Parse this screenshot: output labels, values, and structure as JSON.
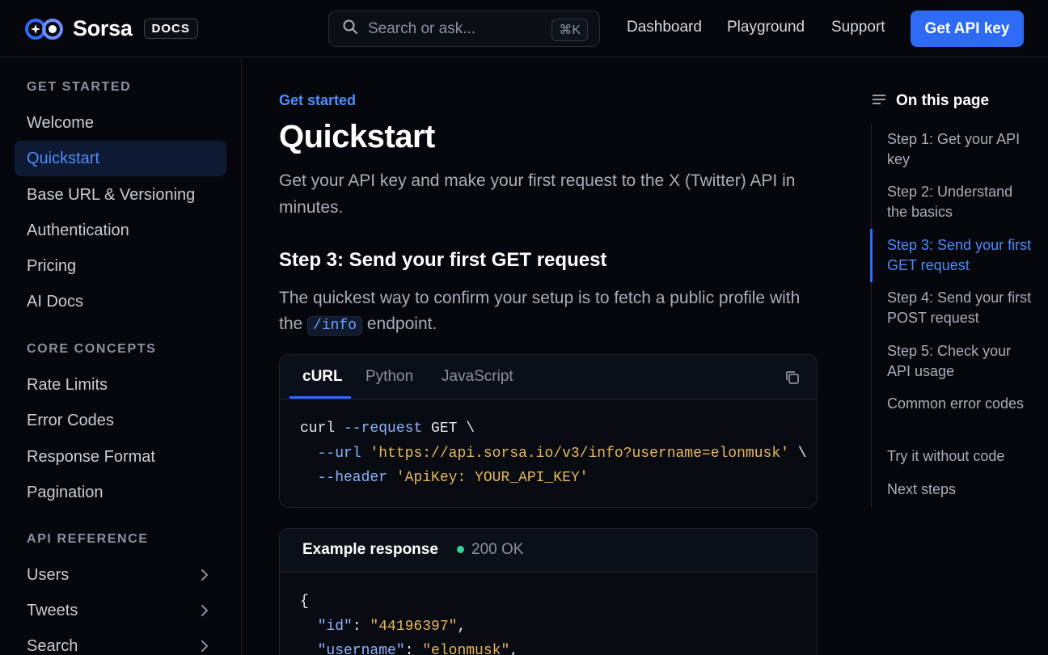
{
  "header": {
    "brand": "Sorsa",
    "badge": "DOCS",
    "search_placeholder": "Search or ask...",
    "search_shortcut": "⌘K",
    "nav": [
      "Dashboard",
      "Playground",
      "Support"
    ],
    "cta": "Get API key"
  },
  "sidebar": {
    "sections": [
      {
        "label": "GET STARTED",
        "items": [
          "Welcome",
          "Quickstart",
          "Base URL & Versioning",
          "Authentication",
          "Pricing",
          "AI Docs"
        ]
      },
      {
        "label": "CORE CONCEPTS",
        "items": [
          "Rate Limits",
          "Error Codes",
          "Response Format",
          "Pagination"
        ]
      },
      {
        "label": "API REFERENCE",
        "items": [
          "Users",
          "Tweets",
          "Search"
        ]
      }
    ],
    "active_item": "Quickstart"
  },
  "main": {
    "eyebrow": "Get started",
    "title": "Quickstart",
    "subtitle": "Get your API key and make your first request to the X (Twitter) API in minutes.",
    "step_heading": "Step 3: Send your first GET request",
    "para_before": "The quickest way to confirm your setup is to fetch a public profile with the ",
    "para_code": "/info",
    "para_after": " endpoint.",
    "code_tabs": [
      "cURL",
      "Python",
      "JavaScript"
    ],
    "active_tab": "cURL",
    "code": {
      "line1_cmd": "curl",
      "line1_flag": "--request",
      "line1_rest": " GET \\",
      "line2_flag": "  --url",
      "line2_str": "'https://api.sorsa.io/v3/info?username=elonmusk'",
      "line2_rest": " \\",
      "line3_flag": "  --header",
      "line3_str": "'ApiKey: YOUR_API_KEY'"
    },
    "response": {
      "title": "Example response",
      "status": "200 OK",
      "line1": "{",
      "line2_key": "  \"id\"",
      "line2_val": "\"44196397\"",
      "line3_key": "  \"username\"",
      "line3_val": "\"elonmusk\""
    }
  },
  "toc": {
    "title": "On this page",
    "items": [
      "Step 1: Get your API key",
      "Step 2: Understand the basics",
      "Step 3: Send your first GET request",
      "Step 4: Send your first POST request",
      "Step 5: Check your API usage",
      "Common error codes",
      "Try it without code",
      "Next steps"
    ],
    "active_index": 2
  },
  "colors": {
    "accent": "#2d6bf4",
    "link": "#4c8dff",
    "background": "#05070c",
    "success": "#34d399",
    "string": "#e8b85a"
  }
}
